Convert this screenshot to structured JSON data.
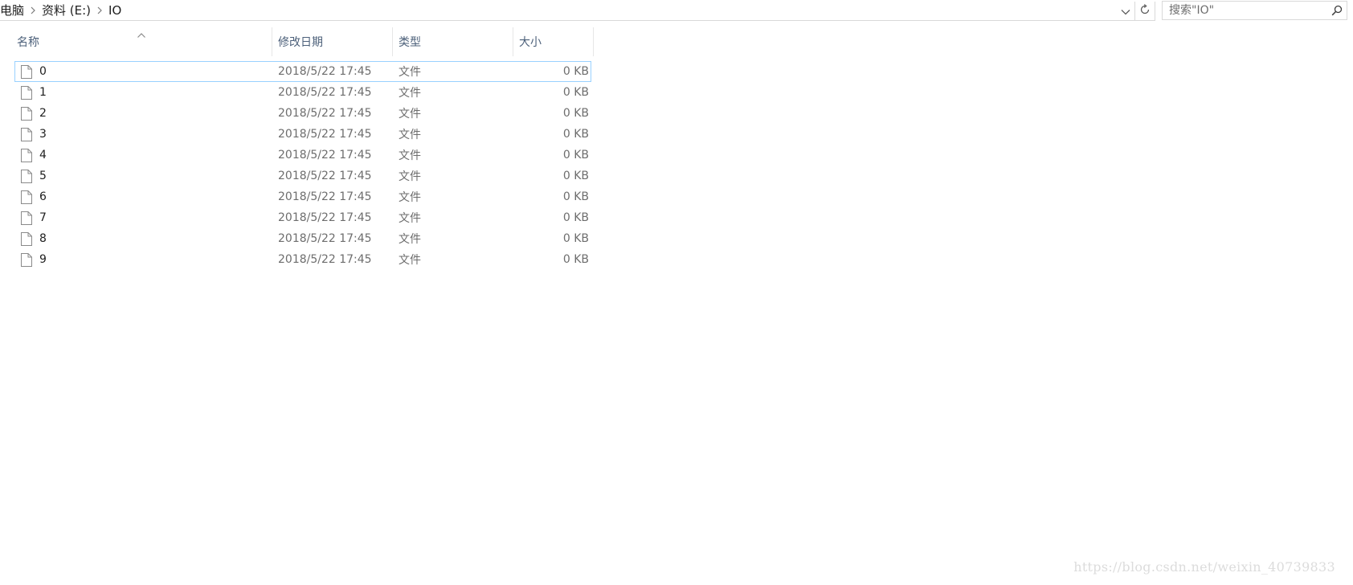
{
  "breadcrumb": {
    "items": [
      "电脑",
      "资料 (E:)",
      "IO"
    ]
  },
  "address": {
    "dropdown_icon": "chevron-down-icon",
    "refresh_icon": "refresh-icon"
  },
  "search": {
    "placeholder": "搜索\"IO\"",
    "value": "",
    "icon": "search-icon"
  },
  "columns": {
    "name": "名称",
    "date": "修改日期",
    "type": "类型",
    "size": "大小",
    "sort_indicator": "sort-ascending-icon"
  },
  "files": [
    {
      "name": "0",
      "modified": "2018/5/22 17:45",
      "type": "文件",
      "size": "0 KB"
    },
    {
      "name": "1",
      "modified": "2018/5/22 17:45",
      "type": "文件",
      "size": "0 KB"
    },
    {
      "name": "2",
      "modified": "2018/5/22 17:45",
      "type": "文件",
      "size": "0 KB"
    },
    {
      "name": "3",
      "modified": "2018/5/22 17:45",
      "type": "文件",
      "size": "0 KB"
    },
    {
      "name": "4",
      "modified": "2018/5/22 17:45",
      "type": "文件",
      "size": "0 KB"
    },
    {
      "name": "5",
      "modified": "2018/5/22 17:45",
      "type": "文件",
      "size": "0 KB"
    },
    {
      "name": "6",
      "modified": "2018/5/22 17:45",
      "type": "文件",
      "size": "0 KB"
    },
    {
      "name": "7",
      "modified": "2018/5/22 17:45",
      "type": "文件",
      "size": "0 KB"
    },
    {
      "name": "8",
      "modified": "2018/5/22 17:45",
      "type": "文件",
      "size": "0 KB"
    },
    {
      "name": "9",
      "modified": "2018/5/22 17:45",
      "type": "文件",
      "size": "0 KB"
    }
  ],
  "watermark": "https://blog.csdn.net/weixin_40739833",
  "colors": {
    "header_text": "#4c607a",
    "secondary_text": "#6d6d6d",
    "focus_border": "#99d1ff"
  }
}
